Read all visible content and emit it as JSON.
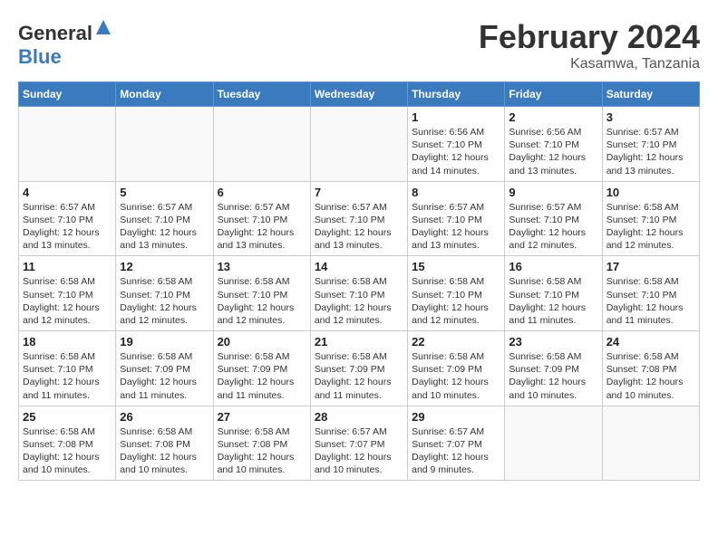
{
  "header": {
    "logo_general": "General",
    "logo_blue": "Blue",
    "month_title": "February 2024",
    "location": "Kasamwa, Tanzania"
  },
  "weekdays": [
    "Sunday",
    "Monday",
    "Tuesday",
    "Wednesday",
    "Thursday",
    "Friday",
    "Saturday"
  ],
  "weeks": [
    [
      {
        "day": "",
        "info": ""
      },
      {
        "day": "",
        "info": ""
      },
      {
        "day": "",
        "info": ""
      },
      {
        "day": "",
        "info": ""
      },
      {
        "day": "1",
        "info": "Sunrise: 6:56 AM\nSunset: 7:10 PM\nDaylight: 12 hours\nand 14 minutes."
      },
      {
        "day": "2",
        "info": "Sunrise: 6:56 AM\nSunset: 7:10 PM\nDaylight: 12 hours\nand 13 minutes."
      },
      {
        "day": "3",
        "info": "Sunrise: 6:57 AM\nSunset: 7:10 PM\nDaylight: 12 hours\nand 13 minutes."
      }
    ],
    [
      {
        "day": "4",
        "info": "Sunrise: 6:57 AM\nSunset: 7:10 PM\nDaylight: 12 hours\nand 13 minutes."
      },
      {
        "day": "5",
        "info": "Sunrise: 6:57 AM\nSunset: 7:10 PM\nDaylight: 12 hours\nand 13 minutes."
      },
      {
        "day": "6",
        "info": "Sunrise: 6:57 AM\nSunset: 7:10 PM\nDaylight: 12 hours\nand 13 minutes."
      },
      {
        "day": "7",
        "info": "Sunrise: 6:57 AM\nSunset: 7:10 PM\nDaylight: 12 hours\nand 13 minutes."
      },
      {
        "day": "8",
        "info": "Sunrise: 6:57 AM\nSunset: 7:10 PM\nDaylight: 12 hours\nand 13 minutes."
      },
      {
        "day": "9",
        "info": "Sunrise: 6:57 AM\nSunset: 7:10 PM\nDaylight: 12 hours\nand 12 minutes."
      },
      {
        "day": "10",
        "info": "Sunrise: 6:58 AM\nSunset: 7:10 PM\nDaylight: 12 hours\nand 12 minutes."
      }
    ],
    [
      {
        "day": "11",
        "info": "Sunrise: 6:58 AM\nSunset: 7:10 PM\nDaylight: 12 hours\nand 12 minutes."
      },
      {
        "day": "12",
        "info": "Sunrise: 6:58 AM\nSunset: 7:10 PM\nDaylight: 12 hours\nand 12 minutes."
      },
      {
        "day": "13",
        "info": "Sunrise: 6:58 AM\nSunset: 7:10 PM\nDaylight: 12 hours\nand 12 minutes."
      },
      {
        "day": "14",
        "info": "Sunrise: 6:58 AM\nSunset: 7:10 PM\nDaylight: 12 hours\nand 12 minutes."
      },
      {
        "day": "15",
        "info": "Sunrise: 6:58 AM\nSunset: 7:10 PM\nDaylight: 12 hours\nand 12 minutes."
      },
      {
        "day": "16",
        "info": "Sunrise: 6:58 AM\nSunset: 7:10 PM\nDaylight: 12 hours\nand 11 minutes."
      },
      {
        "day": "17",
        "info": "Sunrise: 6:58 AM\nSunset: 7:10 PM\nDaylight: 12 hours\nand 11 minutes."
      }
    ],
    [
      {
        "day": "18",
        "info": "Sunrise: 6:58 AM\nSunset: 7:10 PM\nDaylight: 12 hours\nand 11 minutes."
      },
      {
        "day": "19",
        "info": "Sunrise: 6:58 AM\nSunset: 7:09 PM\nDaylight: 12 hours\nand 11 minutes."
      },
      {
        "day": "20",
        "info": "Sunrise: 6:58 AM\nSunset: 7:09 PM\nDaylight: 12 hours\nand 11 minutes."
      },
      {
        "day": "21",
        "info": "Sunrise: 6:58 AM\nSunset: 7:09 PM\nDaylight: 12 hours\nand 11 minutes."
      },
      {
        "day": "22",
        "info": "Sunrise: 6:58 AM\nSunset: 7:09 PM\nDaylight: 12 hours\nand 10 minutes."
      },
      {
        "day": "23",
        "info": "Sunrise: 6:58 AM\nSunset: 7:09 PM\nDaylight: 12 hours\nand 10 minutes."
      },
      {
        "day": "24",
        "info": "Sunrise: 6:58 AM\nSunset: 7:08 PM\nDaylight: 12 hours\nand 10 minutes."
      }
    ],
    [
      {
        "day": "25",
        "info": "Sunrise: 6:58 AM\nSunset: 7:08 PM\nDaylight: 12 hours\nand 10 minutes."
      },
      {
        "day": "26",
        "info": "Sunrise: 6:58 AM\nSunset: 7:08 PM\nDaylight: 12 hours\nand 10 minutes."
      },
      {
        "day": "27",
        "info": "Sunrise: 6:58 AM\nSunset: 7:08 PM\nDaylight: 12 hours\nand 10 minutes."
      },
      {
        "day": "28",
        "info": "Sunrise: 6:57 AM\nSunset: 7:07 PM\nDaylight: 12 hours\nand 10 minutes."
      },
      {
        "day": "29",
        "info": "Sunrise: 6:57 AM\nSunset: 7:07 PM\nDaylight: 12 hours\nand 9 minutes."
      },
      {
        "day": "",
        "info": ""
      },
      {
        "day": "",
        "info": ""
      }
    ]
  ]
}
